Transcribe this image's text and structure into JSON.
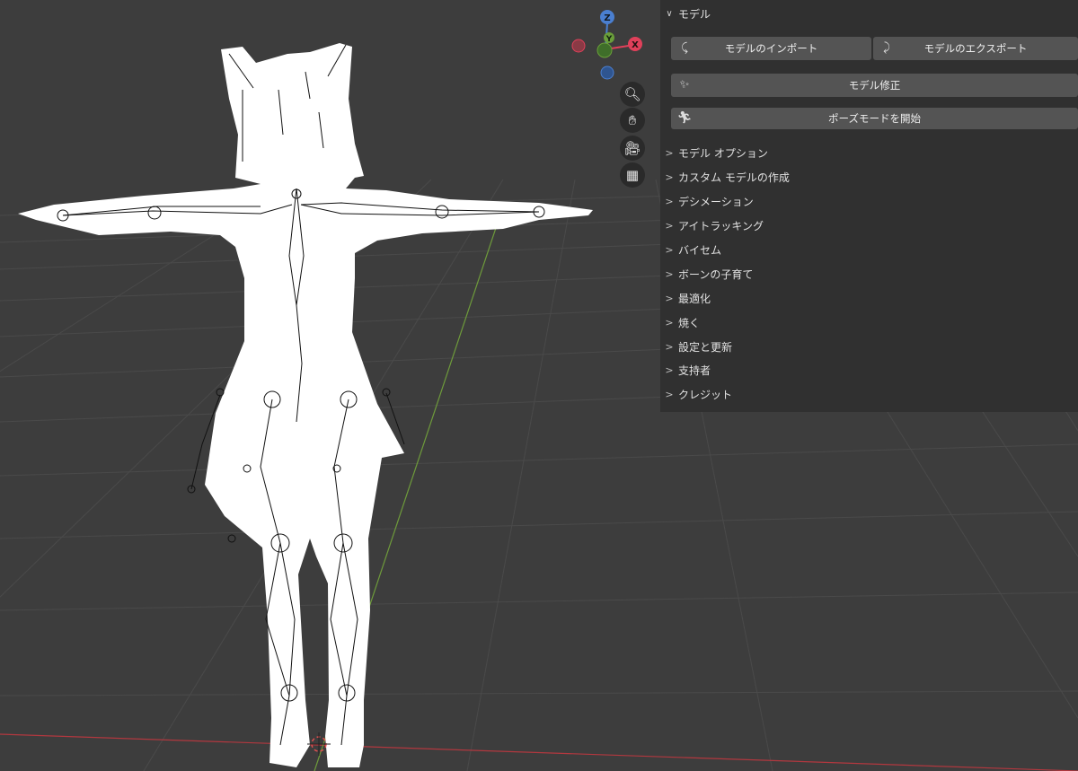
{
  "panel": {
    "title": "モデル",
    "buttons": {
      "import": "モデルのインポート",
      "export": "モデルのエクスポート",
      "fix": "モデル修正",
      "pose": "ポーズモードを開始"
    },
    "sections": [
      "モデル オプション",
      "カスタム モデルの作成",
      "デシメーション",
      "アイトラッキング",
      "バイセム",
      "ボーンの子育て",
      "最適化",
      "焼く",
      "設定と更新",
      "支持者",
      "クレジット"
    ]
  },
  "gizmo": {
    "z": "Z",
    "y": "Y",
    "x": "X"
  },
  "tools": [
    "zoom-icon",
    "hand-icon",
    "camera-icon",
    "grid-icon"
  ],
  "colors": {
    "viewport_bg": "#3d3d3d",
    "panel_bg": "#303030",
    "button_bg": "#545454",
    "x_axis": "#e0405a",
    "y_axis": "#6a9e3a",
    "z_axis": "#4a7fd0"
  }
}
